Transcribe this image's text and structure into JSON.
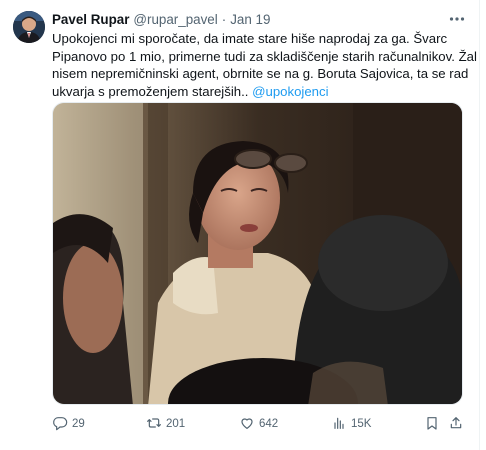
{
  "tweet": {
    "author_name": "Pavel Rupar",
    "handle": "@rupar_pavel",
    "separator": "·",
    "date": "Jan 19",
    "text_lines": [
      "Upokojenci mi sporočate, da imate stare hiše naprodaj za ga. Švarc",
      "Pipanovo po 1 mio, primerne tudi za skladiščenje starih računalnikov. Žal",
      "nisem nepremičninski agent, obrnite se na g. Boruta Sajovica, ta se rad",
      "ukvarja s premoženjem starejših.. "
    ],
    "mention": "@upokojenci"
  },
  "actions": {
    "replies": "29",
    "reposts": "201",
    "likes": "642",
    "views": "15K"
  },
  "icons": {
    "more": "more-dots-icon",
    "reply": "reply-icon",
    "repost": "repost-icon",
    "like": "heart-icon",
    "views": "views-icon",
    "bookmark": "bookmark-icon",
    "share": "share-icon"
  },
  "colors": {
    "link": "#1d9bf0",
    "secondary_text": "#536471",
    "primary_text": "#0f1419"
  }
}
